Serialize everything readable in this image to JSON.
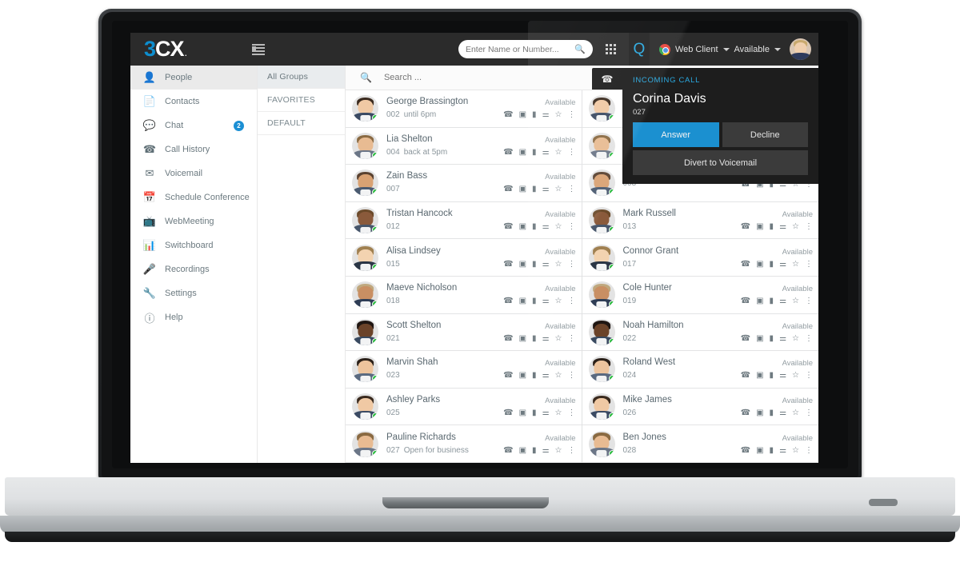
{
  "app": {
    "logo": {
      "part1": "3",
      "part2": "C",
      "part3": "X",
      "dot": "."
    }
  },
  "topbar": {
    "dial_placeholder": "Enter Name or Number...",
    "search_icon": "search-icon",
    "grid_icon": "apps-grid-icon",
    "q_label": "Q",
    "client_label": "Web Client",
    "status_label": "Available",
    "menu_icon": "list-view-icon"
  },
  "sidebar": {
    "items": [
      {
        "label": "People",
        "icon": "person-icon",
        "active": true,
        "badge": ""
      },
      {
        "label": "Contacts",
        "icon": "contact-card-icon",
        "active": false,
        "badge": ""
      },
      {
        "label": "Chat",
        "icon": "chat-bubble-icon",
        "active": false,
        "badge": "2"
      },
      {
        "label": "Call History",
        "icon": "telephone-icon",
        "active": false,
        "badge": ""
      },
      {
        "label": "Voicemail",
        "icon": "envelope-icon",
        "active": false,
        "badge": ""
      },
      {
        "label": "Schedule Conference",
        "icon": "calendar-icon",
        "active": false,
        "badge": ""
      },
      {
        "label": "WebMeeting",
        "icon": "webmeeting-icon",
        "active": false,
        "badge": ""
      },
      {
        "label": "Switchboard",
        "icon": "bar-chart-icon",
        "active": false,
        "badge": ""
      },
      {
        "label": "Recordings",
        "icon": "microphone-icon",
        "active": false,
        "badge": ""
      },
      {
        "label": "Settings",
        "icon": "wrench-icon",
        "active": false,
        "badge": ""
      },
      {
        "label": "Help",
        "icon": "info-icon",
        "active": false,
        "badge": ""
      }
    ]
  },
  "groups": {
    "items": [
      {
        "label": "All Groups",
        "active": true
      },
      {
        "label": "FAVORITES",
        "active": false
      },
      {
        "label": "DEFAULT",
        "active": false
      }
    ]
  },
  "contacts_panel": {
    "search_placeholder": "Search ...",
    "search_icon": "search-icon",
    "row_icons": [
      "call-icon",
      "video-call-icon",
      "chat-icon",
      "conference-icon",
      "favorite-star-icon",
      "more-options-icon"
    ],
    "left_column": [
      {
        "name": "George Brassington",
        "ext": "002",
        "note": "until 6pm",
        "status": "Available"
      },
      {
        "name": "Lia Shelton",
        "ext": "004",
        "note": "back at 5pm",
        "status": "Available"
      },
      {
        "name": "Zain Bass",
        "ext": "007",
        "note": "",
        "status": "Available"
      },
      {
        "name": "Tristan Hancock",
        "ext": "012",
        "note": "",
        "status": "Available"
      },
      {
        "name": "Alisa Lindsey",
        "ext": "015",
        "note": "",
        "status": "Available"
      },
      {
        "name": "Maeve Nicholson",
        "ext": "018",
        "note": "",
        "status": "Available"
      },
      {
        "name": "Scott Shelton",
        "ext": "021",
        "note": "",
        "status": "Available"
      },
      {
        "name": "Marvin Shah",
        "ext": "023",
        "note": "",
        "status": "Available"
      },
      {
        "name": "Ashley Parks",
        "ext": "025",
        "note": "",
        "status": "Available"
      },
      {
        "name": "Pauline Richards",
        "ext": "027",
        "note": "Open for business",
        "status": "Available"
      }
    ],
    "right_column": [
      {
        "name": "",
        "ext": "",
        "note": "",
        "status": "",
        "obscured": true
      },
      {
        "name": "",
        "ext": "",
        "note": "",
        "status": "",
        "obscured": true
      },
      {
        "name": "",
        "ext": "008",
        "note": "",
        "status": "",
        "obscured": true
      },
      {
        "name": "Mark Russell",
        "ext": "013",
        "note": "",
        "status": "Available"
      },
      {
        "name": "Connor Grant",
        "ext": "017",
        "note": "",
        "status": "Available"
      },
      {
        "name": "Cole Hunter",
        "ext": "019",
        "note": "",
        "status": "Available"
      },
      {
        "name": "Noah Hamilton",
        "ext": "022",
        "note": "",
        "status": "Available"
      },
      {
        "name": "Roland West",
        "ext": "024",
        "note": "",
        "status": "Available"
      },
      {
        "name": "Mike James",
        "ext": "026",
        "note": "",
        "status": "Available"
      },
      {
        "name": "Ben Jones",
        "ext": "028",
        "note": "",
        "status": "Available"
      }
    ]
  },
  "incoming_call": {
    "tab_icon": "phone-icon",
    "title": "INCOMING CALL",
    "caller_name": "Corina Davis",
    "caller_ext": "027",
    "answer_label": "Answer",
    "decline_label": "Decline",
    "voicemail_label": "Divert to Voicemail"
  },
  "colors": {
    "brand_blue": "#0d8ecf",
    "answer_blue": "#1b90d0",
    "topbar_dark": "#2b2b2b",
    "panel_dark": "#1d1d1d",
    "status_green": "#26bd3a",
    "badge_blue": "#1b8fd4"
  }
}
